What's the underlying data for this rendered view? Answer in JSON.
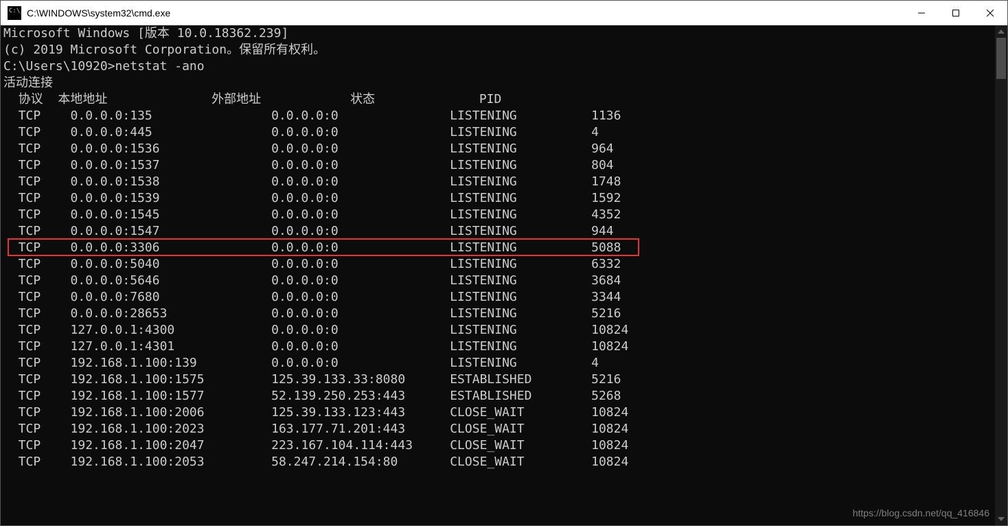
{
  "window": {
    "title": "C:\\WINDOWS\\system32\\cmd.exe"
  },
  "header_lines": [
    "Microsoft Windows [版本 10.0.18362.239]",
    "(c) 2019 Microsoft Corporation。保留所有权利。",
    ""
  ],
  "prompt_line": {
    "prompt": "C:\\Users\\10920>",
    "command": "netstat -ano"
  },
  "section_title": "活动连接",
  "columns": {
    "proto": "协议",
    "local": "本地地址",
    "foreign": "外部地址",
    "state": "状态",
    "pid": "PID"
  },
  "rows": [
    {
      "proto": "TCP",
      "local": "0.0.0.0:135",
      "foreign": "0.0.0.0:0",
      "state": "LISTENING",
      "pid": "1136",
      "hl": false
    },
    {
      "proto": "TCP",
      "local": "0.0.0.0:445",
      "foreign": "0.0.0.0:0",
      "state": "LISTENING",
      "pid": "4",
      "hl": false
    },
    {
      "proto": "TCP",
      "local": "0.0.0.0:1536",
      "foreign": "0.0.0.0:0",
      "state": "LISTENING",
      "pid": "964",
      "hl": false
    },
    {
      "proto": "TCP",
      "local": "0.0.0.0:1537",
      "foreign": "0.0.0.0:0",
      "state": "LISTENING",
      "pid": "804",
      "hl": false
    },
    {
      "proto": "TCP",
      "local": "0.0.0.0:1538",
      "foreign": "0.0.0.0:0",
      "state": "LISTENING",
      "pid": "1748",
      "hl": false
    },
    {
      "proto": "TCP",
      "local": "0.0.0.0:1539",
      "foreign": "0.0.0.0:0",
      "state": "LISTENING",
      "pid": "1592",
      "hl": false
    },
    {
      "proto": "TCP",
      "local": "0.0.0.0:1545",
      "foreign": "0.0.0.0:0",
      "state": "LISTENING",
      "pid": "4352",
      "hl": false
    },
    {
      "proto": "TCP",
      "local": "0.0.0.0:1547",
      "foreign": "0.0.0.0:0",
      "state": "LISTENING",
      "pid": "944",
      "hl": false
    },
    {
      "proto": "TCP",
      "local": "0.0.0.0:3306",
      "foreign": "0.0.0.0:0",
      "state": "LISTENING",
      "pid": "5088",
      "hl": true
    },
    {
      "proto": "TCP",
      "local": "0.0.0.0:5040",
      "foreign": "0.0.0.0:0",
      "state": "LISTENING",
      "pid": "6332",
      "hl": false
    },
    {
      "proto": "TCP",
      "local": "0.0.0.0:5646",
      "foreign": "0.0.0.0:0",
      "state": "LISTENING",
      "pid": "3684",
      "hl": false
    },
    {
      "proto": "TCP",
      "local": "0.0.0.0:7680",
      "foreign": "0.0.0.0:0",
      "state": "LISTENING",
      "pid": "3344",
      "hl": false
    },
    {
      "proto": "TCP",
      "local": "0.0.0.0:28653",
      "foreign": "0.0.0.0:0",
      "state": "LISTENING",
      "pid": "5216",
      "hl": false
    },
    {
      "proto": "TCP",
      "local": "127.0.0.1:4300",
      "foreign": "0.0.0.0:0",
      "state": "LISTENING",
      "pid": "10824",
      "hl": false
    },
    {
      "proto": "TCP",
      "local": "127.0.0.1:4301",
      "foreign": "0.0.0.0:0",
      "state": "LISTENING",
      "pid": "10824",
      "hl": false
    },
    {
      "proto": "TCP",
      "local": "192.168.1.100:139",
      "foreign": "0.0.0.0:0",
      "state": "LISTENING",
      "pid": "4",
      "hl": false
    },
    {
      "proto": "TCP",
      "local": "192.168.1.100:1575",
      "foreign": "125.39.133.33:8080",
      "state": "ESTABLISHED",
      "pid": "5216",
      "hl": false
    },
    {
      "proto": "TCP",
      "local": "192.168.1.100:1577",
      "foreign": "52.139.250.253:443",
      "state": "ESTABLISHED",
      "pid": "5268",
      "hl": false
    },
    {
      "proto": "TCP",
      "local": "192.168.1.100:2006",
      "foreign": "125.39.133.123:443",
      "state": "CLOSE_WAIT",
      "pid": "10824",
      "hl": false
    },
    {
      "proto": "TCP",
      "local": "192.168.1.100:2023",
      "foreign": "163.177.71.201:443",
      "state": "CLOSE_WAIT",
      "pid": "10824",
      "hl": false
    },
    {
      "proto": "TCP",
      "local": "192.168.1.100:2047",
      "foreign": "223.167.104.114:443",
      "state": "CLOSE_WAIT",
      "pid": "10824",
      "hl": false
    },
    {
      "proto": "TCP",
      "local": "192.168.1.100:2053",
      "foreign": "58.247.214.154:80",
      "state": "CLOSE_WAIT",
      "pid": "10824",
      "hl": false
    }
  ],
  "watermark": "https://blog.csdn.net/qq_416846"
}
